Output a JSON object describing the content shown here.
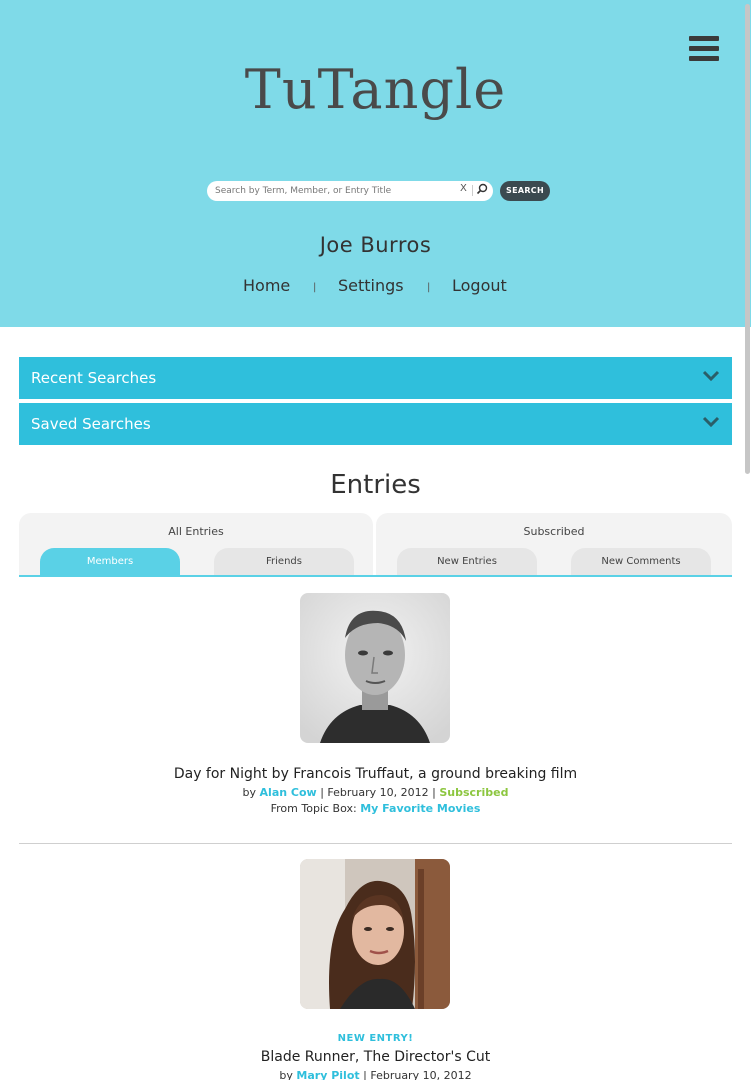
{
  "app": {
    "logo": "TuTangle",
    "menu_icon": "hamburger-icon"
  },
  "search": {
    "placeholder": "Search by Term, Member, or Entry Title",
    "clear_label": "X",
    "button_label": "SEARCH"
  },
  "user": {
    "name": "Joe Burros"
  },
  "nav": {
    "items": [
      {
        "label": "Home"
      },
      {
        "label": "Settings"
      },
      {
        "label": "Logout"
      }
    ],
    "separator": "|"
  },
  "accordions": [
    {
      "label": "Recent Searches",
      "icon": "chevron-down-icon"
    },
    {
      "label": "Saved Searches",
      "icon": "chevron-down-icon"
    }
  ],
  "entries_section": {
    "title": "Entries",
    "tab_groups": [
      {
        "title": "All Entries",
        "tabs": [
          {
            "label": "Members",
            "active": true
          },
          {
            "label": "Friends",
            "active": false
          }
        ]
      },
      {
        "title": "Subscribed",
        "tabs": [
          {
            "label": "New Entries",
            "active": false
          },
          {
            "label": "New Comments",
            "active": false
          }
        ]
      }
    ]
  },
  "entries": [
    {
      "title": "Day for Night by Francois Truffaut, a ground breaking film",
      "by_label": "by",
      "author": "Alan Cow",
      "date": "| February 10, 2012 |",
      "status": "Subscribed",
      "topic_label": "From Topic Box:",
      "topic": "My Favorite Movies"
    },
    {
      "badge": "NEW ENTRY!",
      "title": "Blade Runner, The Director's Cut",
      "by_label": "by",
      "author": "Mary Pilot",
      "date": "| February 10, 2012"
    }
  ],
  "colors": {
    "header_bg": "#7fdae8",
    "accent": "#2fbfdc",
    "subscribed": "#8cc63f",
    "search_button": "#3b4a50"
  }
}
